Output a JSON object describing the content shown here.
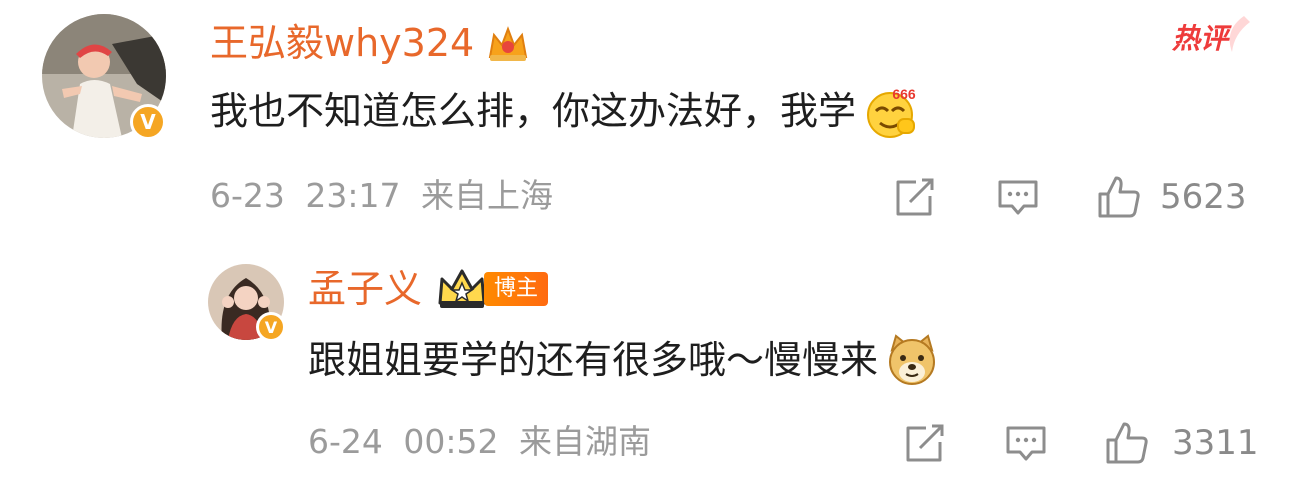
{
  "hot_label": "热评",
  "comment": {
    "username": "王弘毅why324",
    "text": "我也不知道怎么排，你这办法好，我学",
    "emoji_label": "666",
    "date": "6-23",
    "time": "23:17",
    "location": "来自上海",
    "likes": "5623",
    "vip_color": "#f5a623",
    "name_color": "#e8682b"
  },
  "reply": {
    "username": "孟子义",
    "author_tag": "博主",
    "text": "跟姐姐要学的还有很多哦～慢慢来",
    "date": "6-24",
    "time": "00:52",
    "location": "来自湖南",
    "likes": "3311"
  },
  "icons": {
    "share": "share-icon",
    "comment": "comment-icon",
    "like": "thumbs-up-icon",
    "crown": "crown-icon",
    "v_badge": "verified-v-icon",
    "emoji_666": "emoji-666-icon",
    "emoji_doge": "emoji-doge-icon"
  }
}
